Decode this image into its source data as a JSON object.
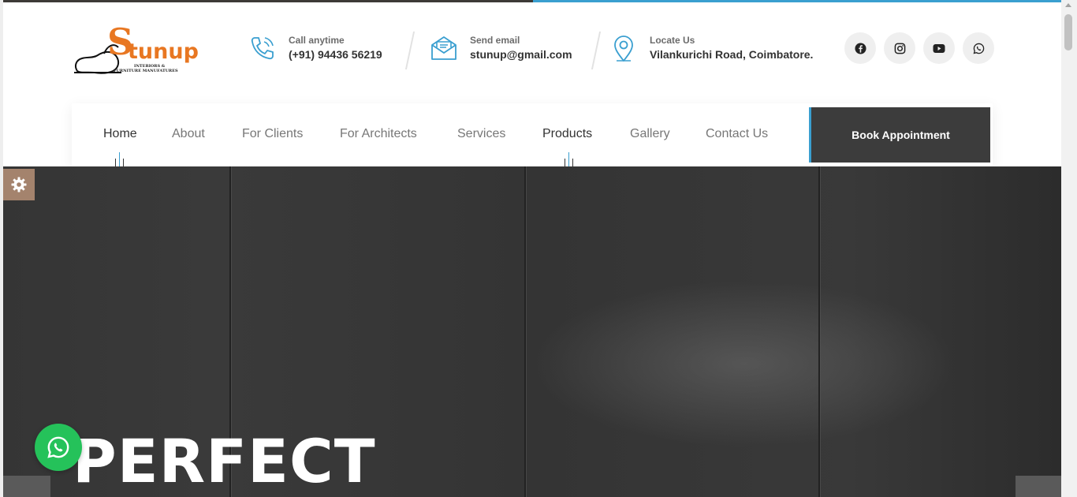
{
  "brand": {
    "logo_letter": "S",
    "logo_word": "tunup",
    "logo_sub_line1": "INTERIORS &",
    "logo_sub_line2": "FURNITURE MANUFATURES"
  },
  "contacts": [
    {
      "label": "Call anytime",
      "value": "(+91) 94436 56219",
      "icon": "phone-icon"
    },
    {
      "label": "Send email",
      "value": "stunup@gmail.com",
      "icon": "email-icon"
    },
    {
      "label": "Locate Us",
      "value": "Vilankurichi Road, Coimbatore.",
      "icon": "location-pin-icon"
    }
  ],
  "social": [
    "facebook-icon",
    "instagram-icon",
    "youtube-icon",
    "whatsapp-icon"
  ],
  "nav": {
    "items": [
      "Home",
      "About",
      "For Clients",
      "For Architects",
      "Services",
      "Products",
      "Gallery",
      "Contact Us"
    ],
    "cta": "Book Appointment"
  },
  "hero": {
    "title": "PERFECT"
  },
  "colors": {
    "accent_orange": "#e87722",
    "accent_blue": "#3a9fd0",
    "dark": "#3c3c3c",
    "whatsapp_green": "#25c25a",
    "settings_brown": "#a4836d"
  }
}
